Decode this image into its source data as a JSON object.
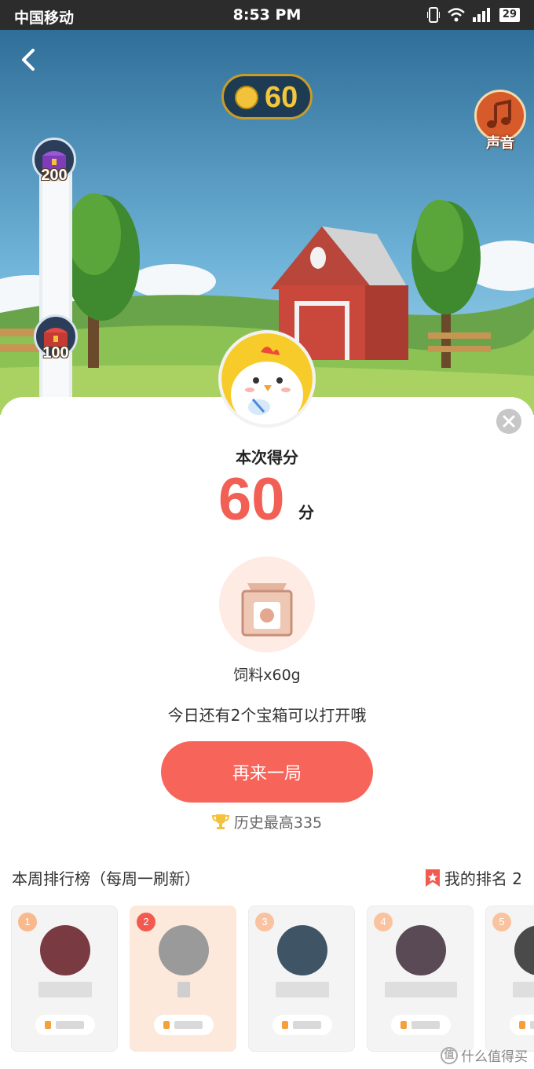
{
  "status_bar": {
    "carrier": "中国移动",
    "time": "8:53 PM",
    "battery": "29"
  },
  "game": {
    "coins": "60",
    "sound_label": "声音",
    "milestones": [
      "200",
      "100"
    ]
  },
  "result": {
    "title": "本次得分",
    "score": "60",
    "unit": "分",
    "reward": "饲料x60g",
    "chest_hint": "今日还有2个宝箱可以打开哦",
    "replay_label": "再来一局",
    "best_score": "历史最高335"
  },
  "leaderboard": {
    "title": "本周排行榜（每周一刷新）",
    "my_rank": "我的排名 2",
    "ranks": [
      "1",
      "2",
      "3",
      "4",
      "5"
    ]
  },
  "watermark": "什么值得买",
  "colors": {
    "accent": "#f7645a",
    "score": "#f15f55",
    "highlight_card": "#fde8dc"
  }
}
